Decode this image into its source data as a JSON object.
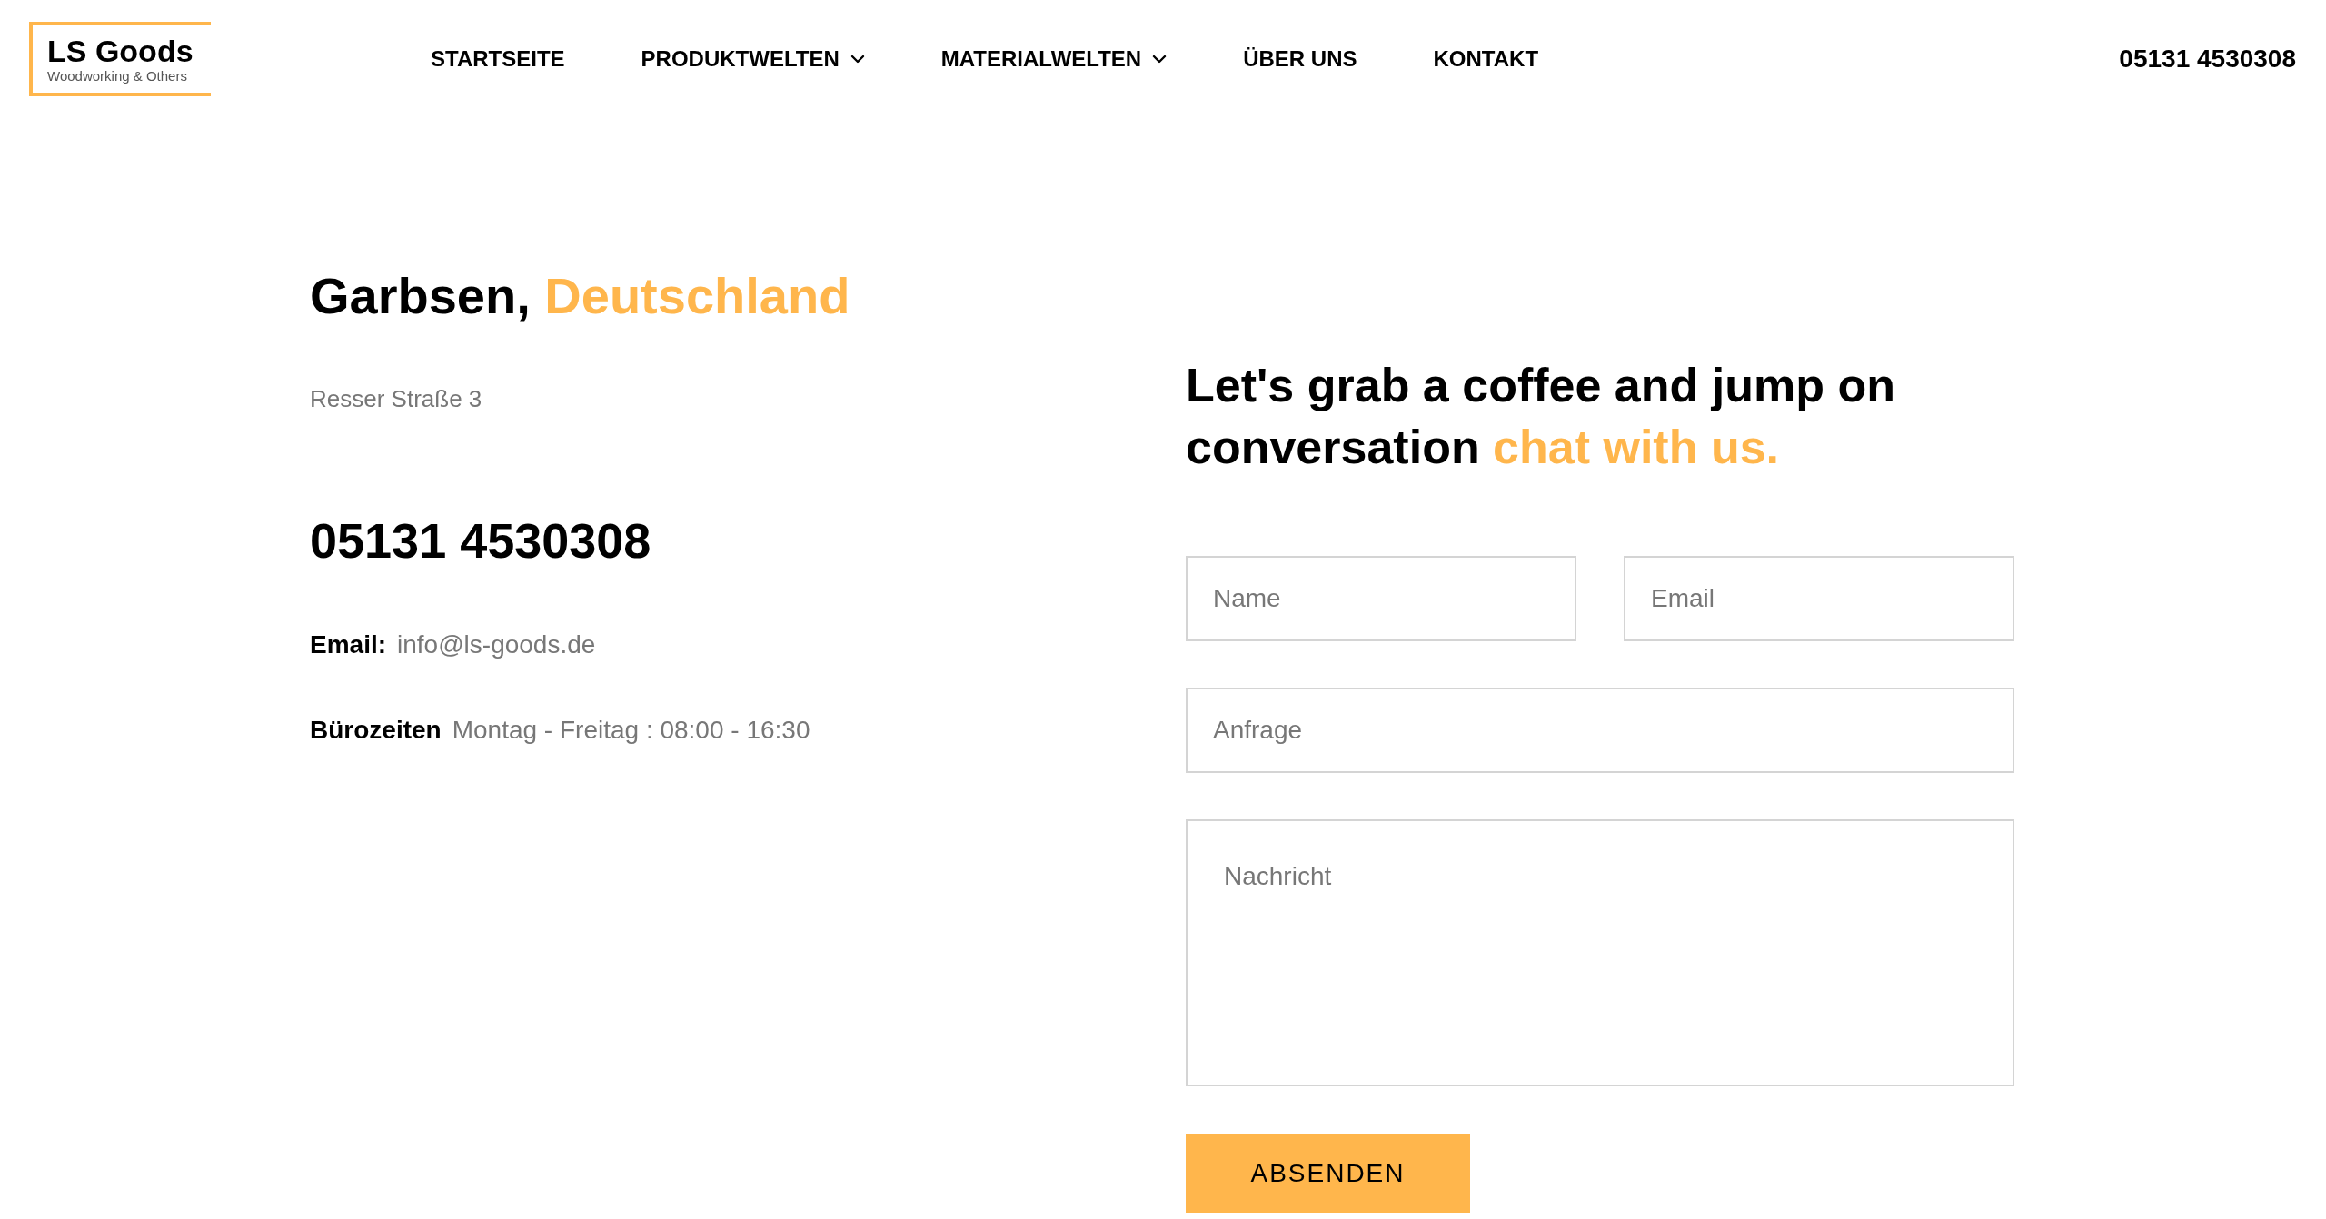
{
  "logo": {
    "title": "LS Goods",
    "subtitle": "Woodworking & Others"
  },
  "nav": [
    {
      "label": "STARTSEITE",
      "has_dropdown": false
    },
    {
      "label": "PRODUKTWELTEN",
      "has_dropdown": true
    },
    {
      "label": "MATERIALWELTEN",
      "has_dropdown": true
    },
    {
      "label": "ÜBER UNS",
      "has_dropdown": false
    },
    {
      "label": "KONTAKT",
      "has_dropdown": false
    }
  ],
  "header_phone": "05131 4530308",
  "location": {
    "city": "Garbsen,",
    "country": "Deutschland",
    "address": "Resser Straße 3",
    "phone": "05131 4530308",
    "email_label": "Email:",
    "email": "info@ls-goods.de",
    "hours_label": "Bürozeiten",
    "hours": "Montag - Freitag : 08:00 - 16:30"
  },
  "form": {
    "heading": "Let's grab a coffee and jump on conversation",
    "heading_highlight": "chat with us.",
    "fields": [
      {
        "placeholder": "Name",
        "kind": "half"
      },
      {
        "placeholder": "Email",
        "kind": "half"
      },
      {
        "placeholder": "Anfrage",
        "kind": "full"
      },
      {
        "placeholder": "Nachricht",
        "kind": "textarea"
      }
    ],
    "submit": "ABSENDEN"
  }
}
